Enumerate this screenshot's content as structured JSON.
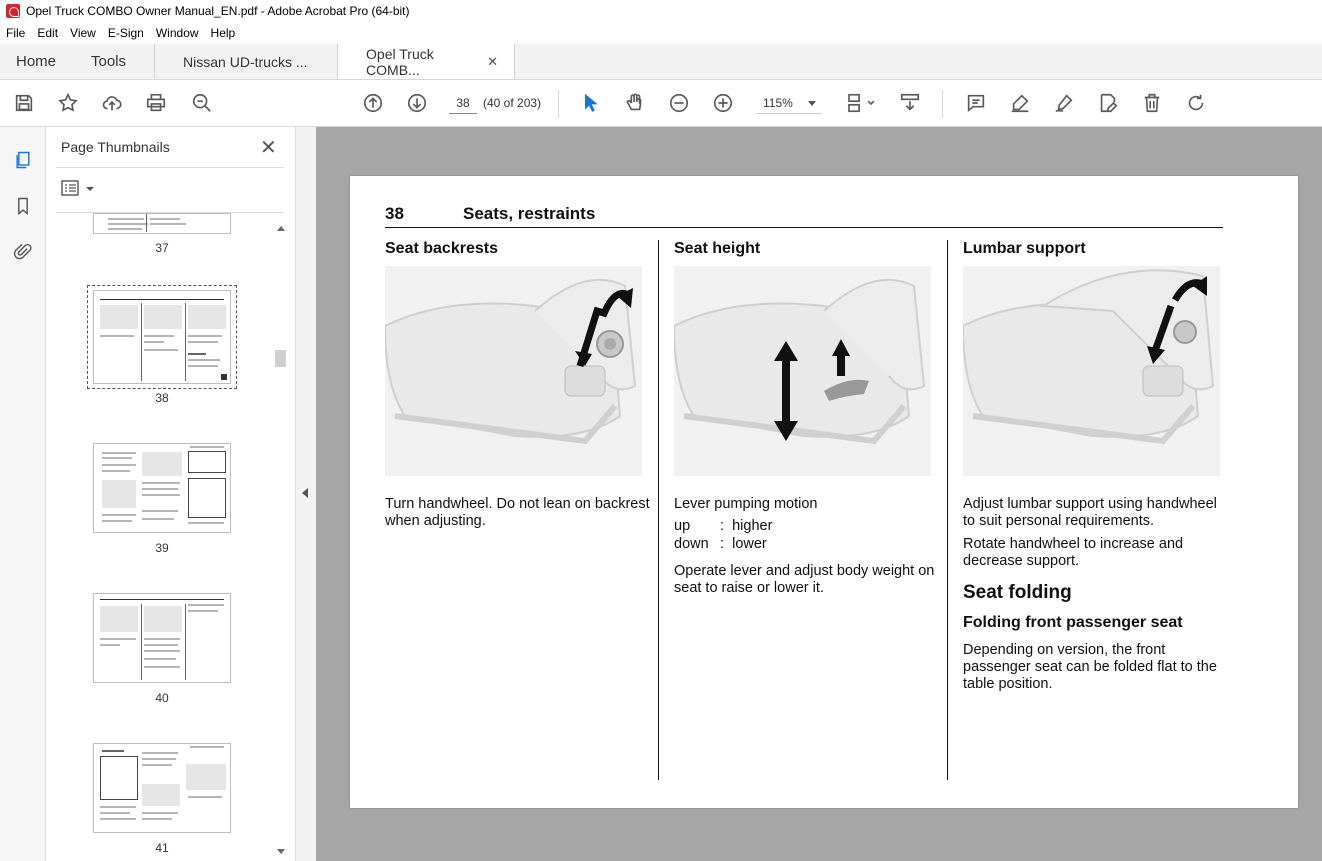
{
  "window": {
    "title": "Opel Truck COMBO Owner Manual_EN.pdf - Adobe Acrobat Pro (64-bit)"
  },
  "menu": [
    "File",
    "Edit",
    "View",
    "E-Sign",
    "Window",
    "Help"
  ],
  "tabs": {
    "home": "Home",
    "tools": "Tools",
    "doc1": "Nissan UD-trucks ...",
    "doc2": "Opel Truck COMB...",
    "close_glyph": "✕"
  },
  "toolbar": {
    "current_page": "38",
    "page_count": "(40 of 203)",
    "zoom": "115%"
  },
  "thumbnails": {
    "title": "Page Thumbnails",
    "close_glyph": "✕",
    "pages": [
      "37",
      "38",
      "39",
      "40",
      "41"
    ]
  },
  "page": {
    "number": "38",
    "section": "Seats, restraints",
    "col1": {
      "heading": "Seat backrests",
      "text": "Turn handwheel. Do not lean on backrest when adjusting."
    },
    "col2": {
      "heading": "Seat height",
      "intro": "Lever pumping motion",
      "rows": [
        {
          "key": "up",
          "sep": ":",
          "val": "higher"
        },
        {
          "key": "down",
          "sep": ":",
          "val": "lower"
        }
      ],
      "text": "Operate lever and adjust body weight on seat to raise or lower it."
    },
    "col3": {
      "heading": "Lumbar support",
      "text1": "Adjust lumbar support using handwheel to suit personal requirements.",
      "text2": "Rotate handwheel to increase and decrease support.",
      "section": "Seat folding",
      "subheading": "Folding front passenger seat",
      "text3": "Depending on version, the front passenger seat can be folded flat to the table position."
    }
  },
  "icons": {
    "save": "save-icon",
    "bookmark": "star-icon",
    "upload": "upload-icon",
    "print": "print-icon",
    "zoom_search": "zoom-search-icon",
    "prev": "arrow-up-icon",
    "next": "arrow-down-icon",
    "select": "cursor-icon",
    "hand": "hand-icon",
    "zoom_out": "zoom-out-icon",
    "zoom_in": "zoom-in-icon"
  }
}
